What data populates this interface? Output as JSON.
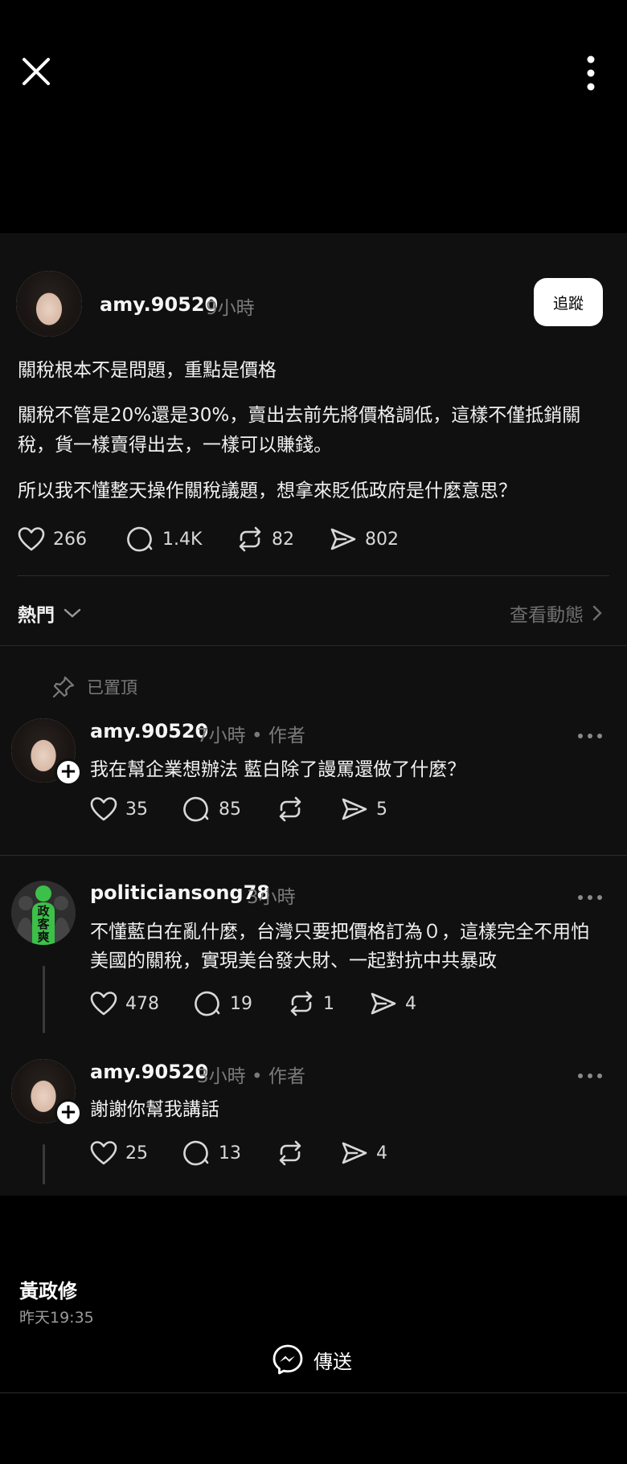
{
  "post": {
    "username": "amy.90520",
    "time": "9小時",
    "follow_label": "追蹤",
    "paragraphs": [
      "關稅根本不是問題，重點是價格",
      "關稅不管是20%還是30%，賣出去前先將價格調低，這樣不僅抵銷關稅，貨一樣賣得出去，一樣可以賺錢。",
      "所以我不懂整天操作關稅議題，想拿來貶低政府是什麼意思？"
    ],
    "likes": "266",
    "comments": "1.4K",
    "reposts": "82",
    "shares": "802"
  },
  "sort": {
    "label": "熱門",
    "activity_label": "查看動態"
  },
  "pinned_label": "已置頂",
  "replies": [
    {
      "username": "amy.90520",
      "meta": "7小時 • 作者",
      "text": "我在幫企業想辦法 藍白除了謾罵還做了什麼？",
      "likes": "35",
      "comments": "85",
      "reposts": "",
      "shares": "5"
    },
    {
      "username": "politiciansong78",
      "meta": "3小時",
      "avatar_text": "政客爽",
      "text": "不懂藍白在亂什麼，台灣只要把價格訂為０，這樣完全不用怕美國的關稅，實現美台發大財、一起對抗中共暴政",
      "likes": "478",
      "comments": "19",
      "reposts": "1",
      "shares": "4"
    },
    {
      "username": "amy.90520",
      "meta": "3小時 • 作者",
      "text": "謝謝你幫我講話",
      "likes": "25",
      "comments": "13",
      "reposts": "",
      "shares": "4"
    }
  ],
  "footer": {
    "sender": "黃政修",
    "time": "昨天19:35",
    "send_label": "傳送"
  },
  "colors": {
    "background": "#000000",
    "card": "#101010",
    "muted": "#7a7a7a",
    "follow_button": "#ffffff"
  }
}
